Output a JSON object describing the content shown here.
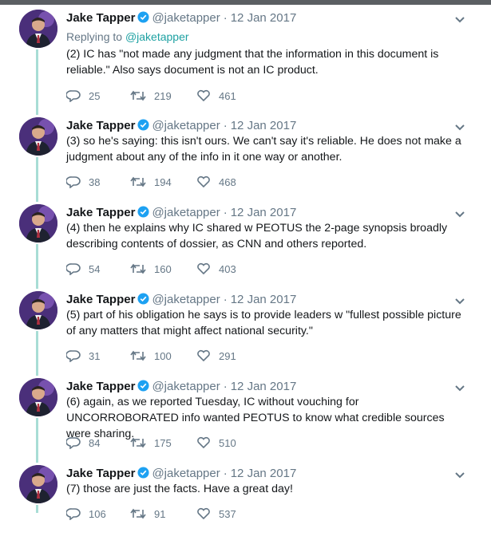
{
  "colors": {
    "thread_line": "#a8ddd5",
    "link": "#1da1a2",
    "verified": "#1da1f2",
    "muted": "#657786"
  },
  "icons": {
    "verified": "verified-badge-icon",
    "caret": "chevron-down-icon",
    "reply": "reply-icon",
    "retweet": "retweet-icon",
    "like": "heart-icon"
  },
  "tweets": [
    {
      "name": "Jake Tapper",
      "handle": "@jaketapper",
      "dot": "·",
      "time": "12 Jan 2017",
      "replying_prefix": "Replying to ",
      "replying_to": "@jaketapper",
      "text": "(2) IC has \"not made any judgment that the information in this document is reliable.\" Also says document is not an IC product.",
      "replies": "25",
      "retweets": "219",
      "likes": "461"
    },
    {
      "name": "Jake Tapper",
      "handle": "@jaketapper",
      "dot": "·",
      "time": "12 Jan 2017",
      "text": "(3) so he's saying: this isn't ours. We can't say it's reliable. He does not make a judgment about any of the info in it one way or another.",
      "replies": "38",
      "retweets": "194",
      "likes": "468"
    },
    {
      "name": "Jake Tapper",
      "handle": "@jaketapper",
      "dot": "·",
      "time": "12 Jan 2017",
      "text": "(4) then he explains why IC shared w PEOTUS the 2-page synopsis broadly describing contents of dossier, as CNN and others reported.",
      "replies": "54",
      "retweets": "160",
      "likes": "403"
    },
    {
      "name": "Jake Tapper",
      "handle": "@jaketapper",
      "dot": "·",
      "time": "12 Jan 2017",
      "text": "(5) part of his obligation he says is to provide leaders w \"fullest possible picture of any matters that might affect national security.\"",
      "replies": "31",
      "retweets": "100",
      "likes": "291"
    },
    {
      "name": "Jake Tapper",
      "handle": "@jaketapper",
      "dot": "·",
      "time": "12 Jan 2017",
      "text": "(6) again, as we reported Tuesday, IC without vouching for UNCORROBORATED info wanted PEOTUS to know what credible sources were sharing.",
      "replies": "84",
      "retweets": "175",
      "likes": "510"
    },
    {
      "name": "Jake Tapper",
      "handle": "@jaketapper",
      "dot": "·",
      "time": "12 Jan 2017",
      "text": "(7) those are just the facts. Have a great day!",
      "replies": "106",
      "retweets": "91",
      "likes": "537"
    }
  ]
}
